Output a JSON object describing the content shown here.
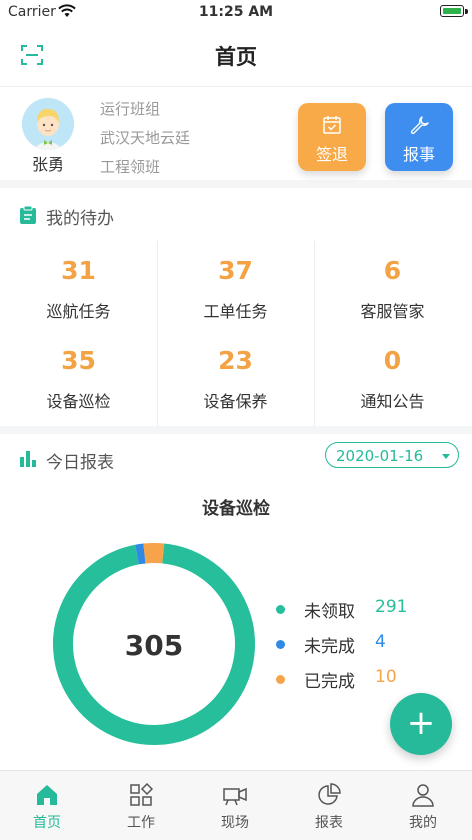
{
  "status_bar": {
    "carrier": "Carrier",
    "time": "11:25 AM"
  },
  "nav": {
    "title": "首页",
    "scan_icon": "scan-icon"
  },
  "profile": {
    "name": "张勇",
    "team": "运行班组",
    "project": "武汉天地云廷",
    "role": "工程领班",
    "actions": [
      {
        "label": "签退",
        "icon": "calendar-check-icon",
        "color": "#f8a948"
      },
      {
        "label": "报事",
        "icon": "wrench-icon",
        "color": "#3e8ef0"
      }
    ]
  },
  "todo": {
    "title": "我的待办",
    "items": [
      {
        "count": "31",
        "label": "巡航任务"
      },
      {
        "count": "37",
        "label": "工单任务"
      },
      {
        "count": "6",
        "label": "客服管家"
      },
      {
        "count": "35",
        "label": "设备巡检"
      },
      {
        "count": "23",
        "label": "设备保养"
      },
      {
        "count": "0",
        "label": "通知公告"
      }
    ]
  },
  "report": {
    "title": "今日报表",
    "date": "2020-01-16",
    "fab_label": "+"
  },
  "chart_data": {
    "type": "pie",
    "title": "设备巡检",
    "center_label": "305",
    "series": [
      {
        "name": "未领取",
        "value": 291,
        "color": "#26be9b"
      },
      {
        "name": "未完成",
        "value": 4,
        "color": "#2f8ae6"
      },
      {
        "name": "已完成",
        "value": 10,
        "color": "#f6a34a"
      }
    ]
  },
  "tabbar": {
    "tabs": [
      {
        "label": "首页",
        "icon": "home-icon",
        "active": true
      },
      {
        "label": "工作",
        "icon": "apps-icon",
        "active": false
      },
      {
        "label": "现场",
        "icon": "camera-icon",
        "active": false
      },
      {
        "label": "报表",
        "icon": "pie-chart-icon",
        "active": false
      },
      {
        "label": "我的",
        "icon": "user-icon",
        "active": false
      }
    ]
  }
}
